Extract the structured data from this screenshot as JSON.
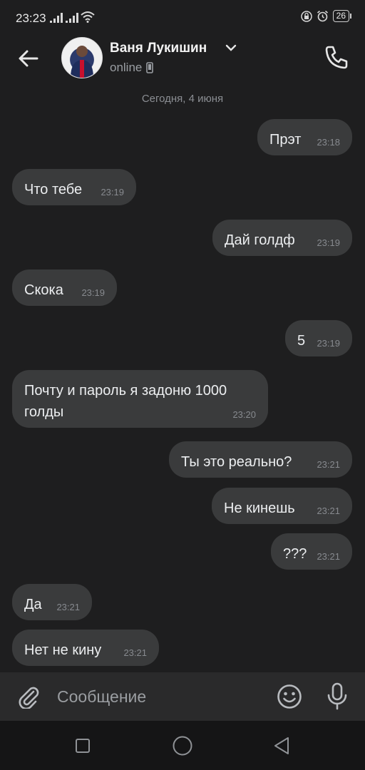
{
  "status_bar": {
    "time": "23:23",
    "battery": "26"
  },
  "header": {
    "name": "Ваня Лукишин",
    "status": "online"
  },
  "date_separator": "Сегодня, 4 июня",
  "messages": [
    {
      "side": "out",
      "text": "Прэт",
      "time": "23:18"
    },
    {
      "side": "in",
      "text": "Что тебе",
      "time": "23:19"
    },
    {
      "side": "out",
      "text": "Дай голдф",
      "time": "23:19"
    },
    {
      "side": "in",
      "text": "Скока",
      "time": "23:19"
    },
    {
      "side": "out",
      "text": "5",
      "time": "23:19"
    },
    {
      "side": "in",
      "text": "Почту и пароль я задоню 1000\nголды",
      "time": "23:20"
    },
    {
      "side": "out",
      "text": "Ты это реально?",
      "time": "23:21"
    },
    {
      "side": "out",
      "text": "Не кинешь",
      "time": "23:21"
    },
    {
      "side": "out",
      "text": "???",
      "time": "23:21"
    },
    {
      "side": "in",
      "text": "Да",
      "time": "23:21"
    },
    {
      "side": "in",
      "text": "Нет не кину",
      "time": "23:21"
    }
  ],
  "composer": {
    "placeholder": "Сообщение"
  }
}
